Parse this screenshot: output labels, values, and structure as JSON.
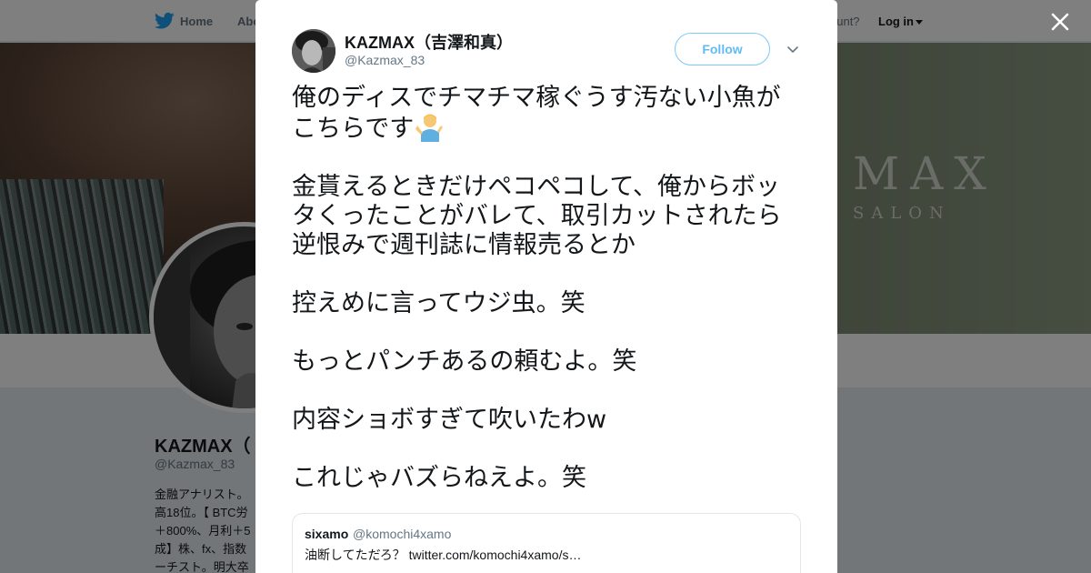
{
  "topnav": {
    "home_label": "Home",
    "about_label": "Abo",
    "account_question": "ccount?",
    "login_label": "Log in"
  },
  "banner": {
    "logo_text": "MAX",
    "logo_sub": "SALON"
  },
  "profile": {
    "name": "KAZMAX（",
    "handle": "@Kazmax_83",
    "bio_lines": [
      "金融アナリスト。",
      "高18位。【 BTC労",
      "＋800%、月利＋5",
      "成】株、fx、指数",
      "ーチスト。明大卒"
    ]
  },
  "modal": {
    "author_name": "KAZMAX（吉澤和真）",
    "author_handle": "@Kazmax_83",
    "follow_label": "Follow",
    "tweet_paragraphs": [
      "俺のディスでチマチマ稼ぐうす汚ない小魚がこちらです",
      "金貰えるときだけペコペコして、俺からボッタくったことがバレて、取引カットされたら逆恨みで週刊誌に情報売るとか",
      "控えめに言ってウジ虫。笑",
      "もっとパンチあるの頼むよ。笑",
      "内容ショボすぎて吹いたわw",
      "これじゃバズらねえよ。笑"
    ],
    "tweet_emoji": "person-shrugging-emoji",
    "quote": {
      "name": "sixamo",
      "handle": "@komochi4xamo",
      "text": "油断してただろ？ twitter.com/komochi4xamo/s…"
    }
  },
  "colors": {
    "twitter_blue": "#1da1f2",
    "text_primary": "#14171a",
    "text_secondary": "#657786"
  }
}
